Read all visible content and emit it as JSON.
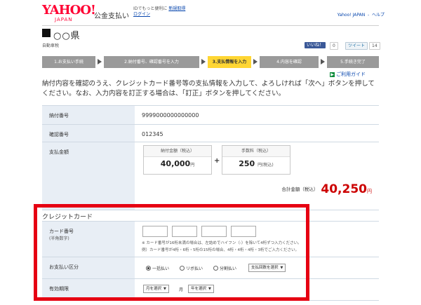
{
  "header": {
    "logo_main": "YAHOO!",
    "logo_sub": "JAPAN",
    "service_name": "公金支払い",
    "login_text": "IDでもっと便利に",
    "register_link": "新規取得",
    "login_link": "ログイン",
    "yahoo_link": "Yahoo! JAPAN",
    "help_link": "ヘルプ"
  },
  "page": {
    "prefecture": "○○県",
    "subtitle": "自動車税",
    "share": {
      "facebook": "いいね！",
      "facebook_count": "0",
      "twitter": "ツイート",
      "twitter_count": "14"
    }
  },
  "steps": [
    {
      "label": "1.お支払い手続"
    },
    {
      "label": "2.納付番号、確認番号を入力"
    },
    {
      "label": "3.支払情報を入力"
    },
    {
      "label": "4.内容を確認"
    },
    {
      "label": "5.手続き完了"
    }
  ],
  "guide_link": "ご利用ガイド",
  "intro_text": "納付内容を確認のうえ、クレジットカード番号等の支払情報を入力して、よろしければ「次へ」ボタンを押してください。なお、入力内容を訂正する場合は、「訂正」ボタンを押してください。",
  "summary": {
    "payment_number_label": "納付番号",
    "payment_number": "9999000000000000",
    "confirm_number_label": "確認番号",
    "confirm_number": "012345",
    "amount_label": "支払金額",
    "payment_amount_caption": "納付金額（税込）",
    "payment_amount": "40,000",
    "payment_amount_unit": "円",
    "fee_caption": "手数料（税込）",
    "fee": "250",
    "fee_unit": "円(税込)",
    "plus": "+",
    "total_label": "合計金額（税込）",
    "total": "40,250",
    "total_unit": "円"
  },
  "credit": {
    "title": "クレジットカード",
    "card_number_label": "カード番号",
    "card_number_sub": "(半角数字)",
    "note1": "※ カード番号が16桁未満の場合は、左詰めでハイフン（-）を除いて4桁ずつ入力ください。",
    "note2": "例）カード番号が4桁・6桁・5桁の15桁の場合、4桁・4桁・4桁・3桁でご入力ください。",
    "payment_method_label": "お支払い区分",
    "radio_lump": "一括払い",
    "radio_revolving": "リボ払い",
    "radio_installment": "分割払い",
    "installment_select": "支払回数を選択",
    "expiry_label": "有効期限",
    "month_select": "月を選択",
    "month_unit": "月",
    "year_select": "年を選択"
  },
  "colors": {
    "highlight": "#e60012",
    "active_step": "#ffd633",
    "total_amount": "#cc0000"
  }
}
